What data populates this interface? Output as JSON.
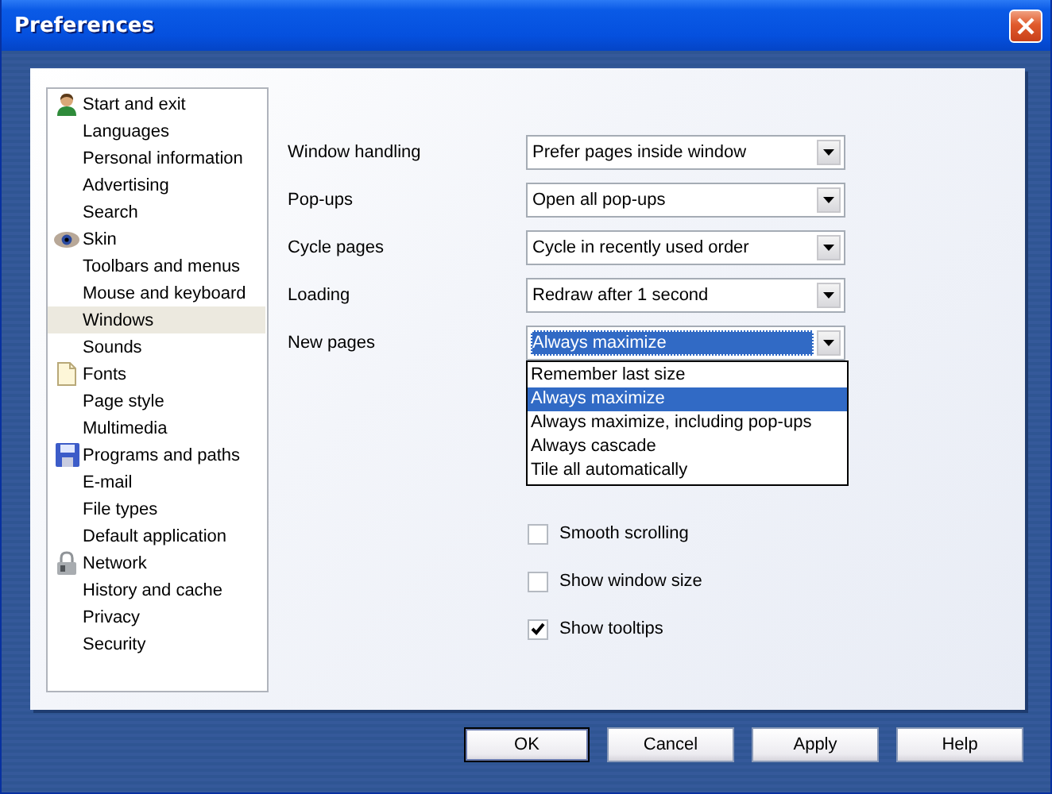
{
  "window": {
    "title": "Preferences"
  },
  "sidebar": {
    "items": [
      {
        "label": "Start and exit",
        "kind": "person",
        "selected": false
      },
      {
        "label": "Languages",
        "selected": false
      },
      {
        "label": "Personal information",
        "selected": false
      },
      {
        "label": "Advertising",
        "selected": false
      },
      {
        "label": "Search",
        "selected": false
      },
      {
        "label": "Skin",
        "kind": "eye",
        "selected": false
      },
      {
        "label": "Toolbars and menus",
        "selected": false
      },
      {
        "label": "Mouse and keyboard",
        "selected": false
      },
      {
        "label": "Windows",
        "selected": true
      },
      {
        "label": "Sounds",
        "selected": false
      },
      {
        "label": "Fonts",
        "kind": "page",
        "selected": false
      },
      {
        "label": "Page style",
        "selected": false
      },
      {
        "label": "Multimedia",
        "selected": false
      },
      {
        "label": "Programs and paths",
        "kind": "disk",
        "selected": false
      },
      {
        "label": "E-mail",
        "selected": false
      },
      {
        "label": "File types",
        "selected": false
      },
      {
        "label": "Default application",
        "selected": false
      },
      {
        "label": "Network",
        "kind": "lock",
        "selected": false
      },
      {
        "label": "History and cache",
        "selected": false
      },
      {
        "label": "Privacy",
        "selected": false
      },
      {
        "label": "Security",
        "selected": false
      }
    ]
  },
  "form": {
    "rows": [
      {
        "label": "Window handling",
        "value": "Prefer pages inside window",
        "focused": false
      },
      {
        "label": "Pop-ups",
        "value": "Open all pop-ups",
        "focused": false
      },
      {
        "label": "Cycle pages",
        "value": "Cycle in recently used order",
        "focused": false
      },
      {
        "label": "Loading",
        "value": "Redraw after 1 second",
        "focused": false
      },
      {
        "label": "New pages",
        "value": "Always maximize",
        "focused": true,
        "options": [
          {
            "label": "Remember last size",
            "selected": false
          },
          {
            "label": "Always maximize",
            "selected": true
          },
          {
            "label": "Always maximize, including pop-ups",
            "selected": false
          },
          {
            "label": "Always cascade",
            "selected": false
          },
          {
            "label": "Tile all automatically",
            "selected": false
          }
        ]
      }
    ],
    "checkboxes": [
      {
        "label": "Smooth scrolling",
        "checked": false
      },
      {
        "label": "Show window size",
        "checked": false
      },
      {
        "label": "Show tooltips",
        "checked": true
      }
    ]
  },
  "buttons": [
    {
      "label": "OK",
      "default": true
    },
    {
      "label": "Cancel",
      "default": false
    },
    {
      "label": "Apply",
      "default": false
    },
    {
      "label": "Help",
      "default": false
    }
  ]
}
